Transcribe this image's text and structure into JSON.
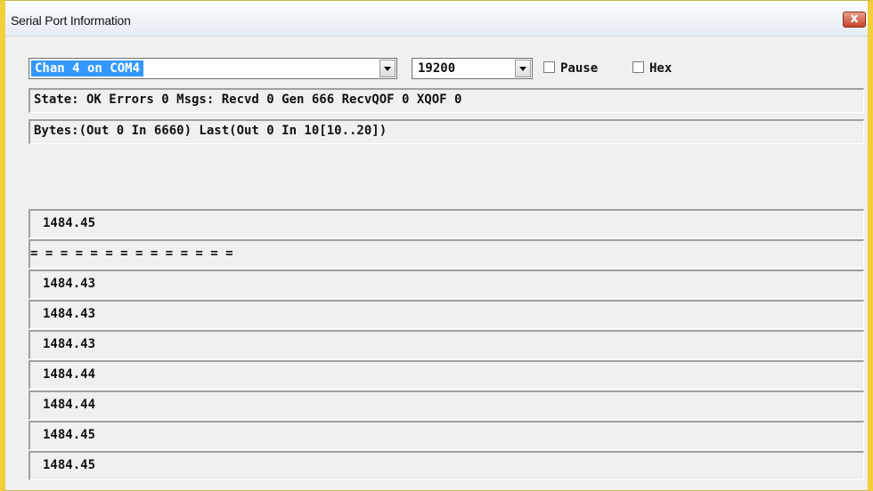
{
  "window": {
    "title": "Serial Port Information",
    "close_glyph": "x"
  },
  "controls": {
    "channel_select": {
      "value": "Chan 4 on COM4"
    },
    "baud_select": {
      "value": "19200"
    },
    "pause_checkbox": {
      "label": "Pause",
      "checked": false
    },
    "hex_checkbox": {
      "label": "Hex",
      "checked": false
    }
  },
  "status": {
    "state_line": "State: OK Errors 0 Msgs: Recvd 0 Gen 666 RecvQOF 0 XQOF 0",
    "bytes_line": "Bytes:(Out 0 In 6660) Last(Out 0 In 10[10..20])"
  },
  "readings": [
    "1484.45",
    "= = = = = = = = = = = = = =",
    "1484.43",
    "1484.43",
    "1484.43",
    "1484.44",
    "1484.44",
    "1484.45",
    "1484.45"
  ],
  "colors": {
    "selection_blue": "#3399ff",
    "window_frame": "#f3cf3a",
    "close_red": "#c5432a"
  }
}
